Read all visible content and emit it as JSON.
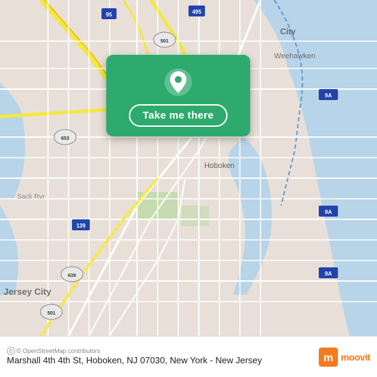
{
  "map": {
    "backgroundColor": "#e8e0d8",
    "waterColor": "#b8d4e8",
    "roadColor": "#ffffff",
    "highlightRoadColor": "#f5e642",
    "greenColor": "#a8c878"
  },
  "card": {
    "backgroundColor": "#2eaa6e",
    "button_label": "Take me there"
  },
  "footer": {
    "attribution_text": "© OpenStreetMap contributors",
    "address": "Marshall 4th 4th St, Hoboken, NJ 07030, New York - New Jersey",
    "moovit_label": "moovit"
  }
}
